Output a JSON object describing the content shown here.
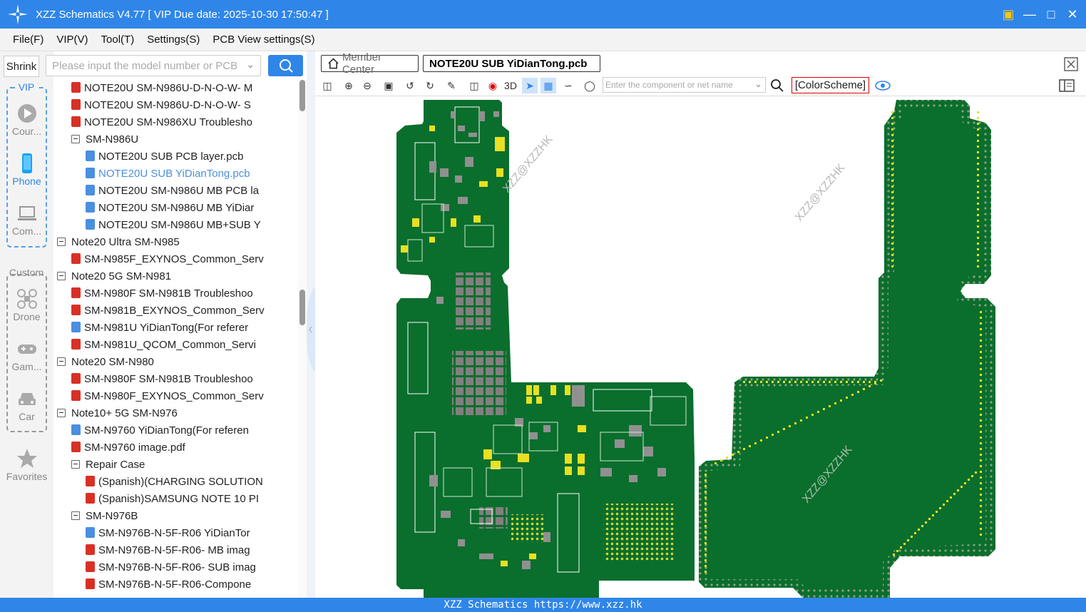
{
  "window": {
    "title": "XZZ Schematics V4.77 [ VIP Due date: 2025-10-30 17:50:47 ]"
  },
  "menu": [
    "File(F)",
    "VIP(V)",
    "Tool(T)",
    "Settings(S)",
    "PCB View settings(S)"
  ],
  "sidebar": {
    "shrink_label": "Shrink",
    "vip_label": "VIP",
    "custom_label": "Custom",
    "vip_items": [
      {
        "label": "Cour...",
        "icon": "play-icon"
      },
      {
        "label": "Phone",
        "icon": "phone-icon",
        "active": true
      },
      {
        "label": "Com...",
        "icon": "laptop-icon"
      }
    ],
    "custom_items": [
      {
        "label": "Drone",
        "icon": "drone-icon"
      },
      {
        "label": "Gam...",
        "icon": "gamepad-icon"
      },
      {
        "label": "Car",
        "icon": "car-icon"
      }
    ],
    "favorites_label": "Favorites"
  },
  "search": {
    "placeholder": "Please input the model number or PCB"
  },
  "tree": [
    {
      "label": "NOTE20U SM-N986U-D-N-O-W- M",
      "type": "pdf",
      "level": 1
    },
    {
      "label": "NOTE20U SM-N986U-D-N-O-W- S",
      "type": "pdf",
      "level": 1
    },
    {
      "label": "NOTE20U SM-N986XU Troublesho",
      "type": "pdf",
      "level": 1
    },
    {
      "label": "SM-N986U",
      "type": "folder",
      "level": 1
    },
    {
      "label": "NOTE20U  SUB PCB layer.pcb",
      "type": "pcb",
      "level": 2
    },
    {
      "label": "NOTE20U  SUB YiDianTong.pcb",
      "type": "pcb",
      "level": 2,
      "selected": true
    },
    {
      "label": "NOTE20U SM-N986U MB PCB la",
      "type": "pcb",
      "level": 2
    },
    {
      "label": "NOTE20U SM-N986U MB YiDiar",
      "type": "pcb",
      "level": 2
    },
    {
      "label": "NOTE20U SM-N986U MB+SUB Y",
      "type": "pcb",
      "level": 2
    },
    {
      "label": "Note20 Ultra SM-N985",
      "type": "folder",
      "level": 0
    },
    {
      "label": "SM-N985F_EXYNOS_Common_Serv",
      "type": "pdf",
      "level": 1
    },
    {
      "label": "Note20 5G SM-N981",
      "type": "folder",
      "level": 0
    },
    {
      "label": "SM-N980F SM-N981B Troubleshoo",
      "type": "pdf",
      "level": 1
    },
    {
      "label": "SM-N981B_EXYNOS_Common_Serv",
      "type": "pdf",
      "level": 1
    },
    {
      "label": "SM-N981U YiDianTong(For referer",
      "type": "pcb",
      "level": 1
    },
    {
      "label": "SM-N981U_QCOM_Common_Servi",
      "type": "pdf",
      "level": 1
    },
    {
      "label": "Note20 SM-N980",
      "type": "folder",
      "level": 0
    },
    {
      "label": "SM-N980F SM-N981B Troubleshoo",
      "type": "pdf",
      "level": 1
    },
    {
      "label": "SM-N980F_EXYNOS_Common_Serv",
      "type": "pdf",
      "level": 1
    },
    {
      "label": "Note10+ 5G SM-N976",
      "type": "folder",
      "level": 0
    },
    {
      "label": "SM-N9760 YiDianTong(For referen",
      "type": "pcb",
      "level": 1
    },
    {
      "label": "SM-N9760 image.pdf",
      "type": "pdf",
      "level": 1
    },
    {
      "label": "Repair Case",
      "type": "folder",
      "level": 1
    },
    {
      "label": "(Spanish)(CHARGING SOLUTION",
      "type": "pdf",
      "level": 2
    },
    {
      "label": "(Spanish)SAMSUNG NOTE 10 PI",
      "type": "pdf",
      "level": 2
    },
    {
      "label": "SM-N976B",
      "type": "folder",
      "level": 1
    },
    {
      "label": "SM-N976B-N-5F-R06 YiDianTor",
      "type": "pcb",
      "level": 2
    },
    {
      "label": "SM-N976B-N-5F-R06- MB imag",
      "type": "pdf",
      "level": 2
    },
    {
      "label": "SM-N976B-N-5F-R06- SUB imag",
      "type": "pdf",
      "level": 2
    },
    {
      "label": "SM-N976B-N-5F-R06-Compone",
      "type": "pdf",
      "level": 2
    }
  ],
  "tabs": {
    "member": "Member Center",
    "file": "NOTE20U  SUB YiDianTong.pcb"
  },
  "toolbar": {
    "label_3d": "3D",
    "comp_placeholder": "Enter the component or net name",
    "color_scheme": "[ColorScheme]"
  },
  "watermark": "XZZ@XZZHK",
  "status": "XZZ Schematics https://www.xzz.hk",
  "colors": {
    "accent": "#2f86e8",
    "pcb_green": "#0a6e2d",
    "pad_yellow": "#e8e020"
  }
}
